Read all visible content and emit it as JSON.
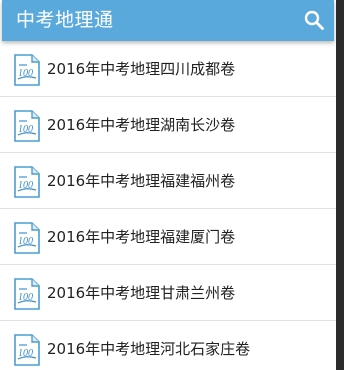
{
  "app": {
    "title": "中考地理通",
    "search_icon": "search-icon",
    "accent": "#5aa9dd"
  },
  "list": {
    "item_icon": "document-100-icon",
    "items": [
      {
        "label": "2016年中考地理四川成都卷"
      },
      {
        "label": "2016年中考地理湖南长沙卷"
      },
      {
        "label": "2016年中考地理福建福州卷"
      },
      {
        "label": "2016年中考地理福建厦门卷"
      },
      {
        "label": "2016年中考地理甘肃兰州卷"
      },
      {
        "label": "2016年中考地理河北石家庄卷"
      }
    ]
  }
}
